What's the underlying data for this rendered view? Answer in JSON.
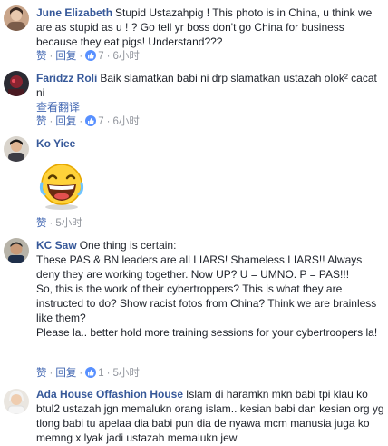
{
  "comments": [
    {
      "name": "June Elizabeth",
      "text": "Stupid Ustazahpig ! This photo is in China, u think we are as stupid as u ! ? Go tell yr boss don't go China for business because they eat pigs! Understand???",
      "like": "赞",
      "reply": "回复",
      "reactions": "7",
      "time": "6小时"
    },
    {
      "name": "Faridzz Roli",
      "text": "Baik slamatkan babi ni drp slamatkan ustazah olok² cacat ni",
      "translate": "查看翻译",
      "like": "赞",
      "reply": "回复",
      "reactions": "7",
      "time": "6小时"
    },
    {
      "name": "Ko Yiee",
      "like": "赞",
      "time": "5小时"
    },
    {
      "name": "KC Saw",
      "text_lines": [
        "One thing is certain:",
        "These PAS & BN leaders are all LIARS! Shameless LIARS!! Always deny they are working together. Now UP? U = UMNO. P = PAS!!!",
        "So, this is the work of their cybertroppers? This is what they are instructed to do? Show racist fotos from China? Think we are brainless like them?",
        "Please la.. better hold more training sessions for your cybertroopers la!"
      ],
      "like": "赞",
      "reply": "回复",
      "reactions": "1",
      "time": "5小时"
    },
    {
      "name": "Ada House Offashion House",
      "text": "Islam di haramkn mkn babi tpi klau ko btul2 ustazah jgn memalukn orang islam.. kesian babi dan kesian org yg tlong babi tu apelaa dia babi pun dia de nyawa mcm manusia juga ko memng x lyak jadi ustazah memalukn jew"
    }
  ],
  "colors": {
    "name": "#365899",
    "meta": "#90949c",
    "link": "#4267b2",
    "like_badge": "#5890ff"
  }
}
